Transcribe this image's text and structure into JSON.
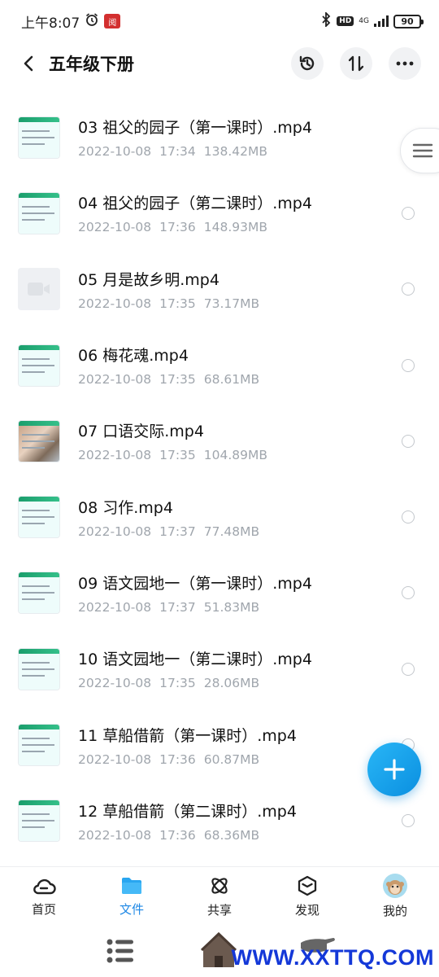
{
  "status_bar": {
    "time": "上午8:07",
    "app_icon_text": "阅",
    "hd": "HD",
    "network": "4G",
    "network_sub": "4G",
    "battery": "90"
  },
  "header": {
    "title": "五年级下册"
  },
  "files": [
    {
      "name": "03 祖父的园子（第一课时）.mp4",
      "date": "2022-10-08",
      "time": "17:34",
      "size": "138.42MB",
      "thumb": "text"
    },
    {
      "name": "04 祖父的园子（第二课时）.mp4",
      "date": "2022-10-08",
      "time": "17:36",
      "size": "148.93MB",
      "thumb": "text"
    },
    {
      "name": "05 月是故乡明.mp4",
      "date": "2022-10-08",
      "time": "17:35",
      "size": "73.17MB",
      "thumb": "video"
    },
    {
      "name": "06 梅花魂.mp4",
      "date": "2022-10-08",
      "time": "17:35",
      "size": "68.61MB",
      "thumb": "text"
    },
    {
      "name": "07 口语交际.mp4",
      "date": "2022-10-08",
      "time": "17:35",
      "size": "104.89MB",
      "thumb": "photo"
    },
    {
      "name": "08 习作.mp4",
      "date": "2022-10-08",
      "time": "17:37",
      "size": "77.48MB",
      "thumb": "text"
    },
    {
      "name": "09 语文园地一（第一课时）.mp4",
      "date": "2022-10-08",
      "time": "17:37",
      "size": "51.83MB",
      "thumb": "text"
    },
    {
      "name": "10 语文园地一（第二课时）.mp4",
      "date": "2022-10-08",
      "time": "17:35",
      "size": "28.06MB",
      "thumb": "text"
    },
    {
      "name": "11 草船借箭（第一课时）.mp4",
      "date": "2022-10-08",
      "time": "17:36",
      "size": "60.87MB",
      "thumb": "text"
    },
    {
      "name": "12 草船借箭（第二课时）.mp4",
      "date": "2022-10-08",
      "time": "17:36",
      "size": "68.36MB",
      "thumb": "text"
    }
  ],
  "bottom_nav": [
    {
      "label": "首页",
      "icon": "cloud-icon",
      "active": false
    },
    {
      "label": "文件",
      "icon": "folder-icon",
      "active": true
    },
    {
      "label": "共享",
      "icon": "atom-icon",
      "active": false
    },
    {
      "label": "发现",
      "icon": "cube-icon",
      "active": false
    },
    {
      "label": "我的",
      "icon": "avatar",
      "active": false
    }
  ],
  "watermark": "WWW.XXTTQ.COM",
  "colors": {
    "accent": "#1e88e5",
    "fab": "#0a8fe0",
    "meta_text": "#a0a6ad"
  }
}
